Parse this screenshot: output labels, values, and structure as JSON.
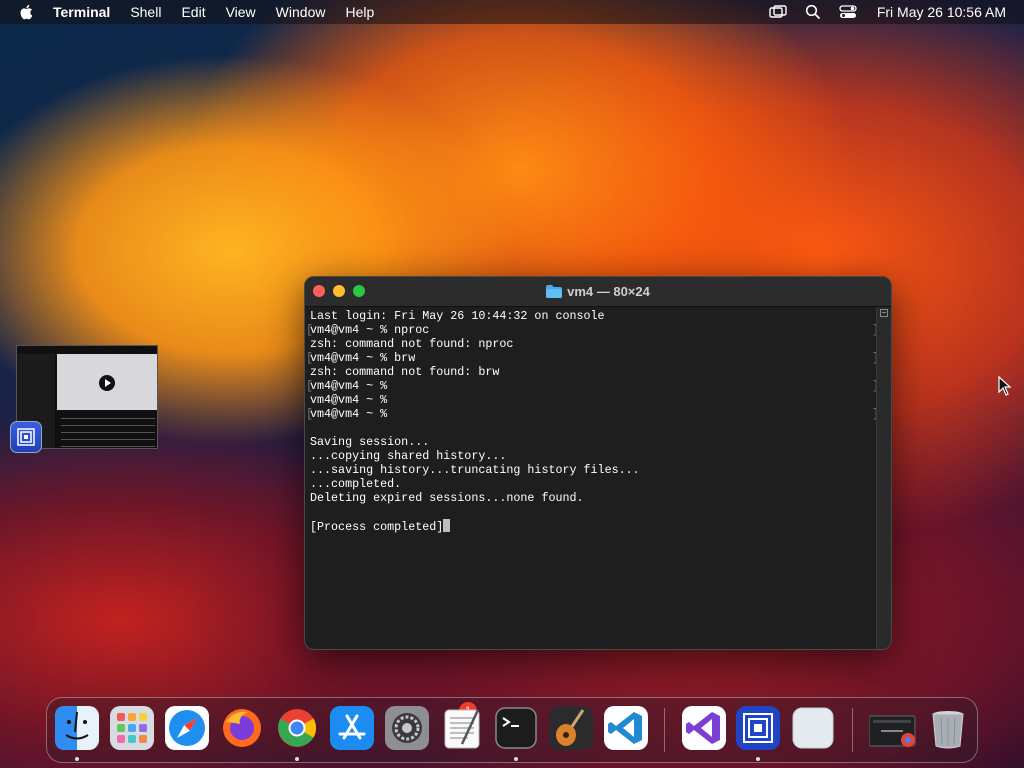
{
  "menubar": {
    "app_name": "Terminal",
    "items": [
      "Shell",
      "Edit",
      "View",
      "Window",
      "Help"
    ],
    "clock": "Fri May 26  10:56 AM"
  },
  "terminal": {
    "title": "vm4 — 80×24",
    "lines": [
      "Last login: Fri May 26 10:44:32 on console",
      "vm4@vm4 ~ % nproc",
      "zsh: command not found: nproc",
      "vm4@vm4 ~ % brw",
      "zsh: command not found: brw",
      "vm4@vm4 ~ %",
      "vm4@vm4 ~ %",
      "vm4@vm4 ~ %",
      "",
      "Saving session...",
      "...copying shared history...",
      "...saving history...truncating history files...",
      "...completed.",
      "Deleting expired sessions...none found.",
      "",
      "[Process completed]"
    ]
  },
  "dock": {
    "apps": [
      "finder",
      "launchpad",
      "safari",
      "firefox",
      "chrome",
      "app-store",
      "system-settings",
      "textedit",
      "terminal",
      "garageband",
      "vscode",
      "visual-studio",
      "remote-desktop",
      "preview",
      "chrome-window",
      "trash"
    ],
    "settings_badge": "1"
  },
  "colors": {
    "terminal_bg": "#1e1e1e",
    "titlebar_bg": "#2c2c2c",
    "close": "#ff5f57",
    "minimize": "#febc2e",
    "zoom": "#28c840"
  }
}
